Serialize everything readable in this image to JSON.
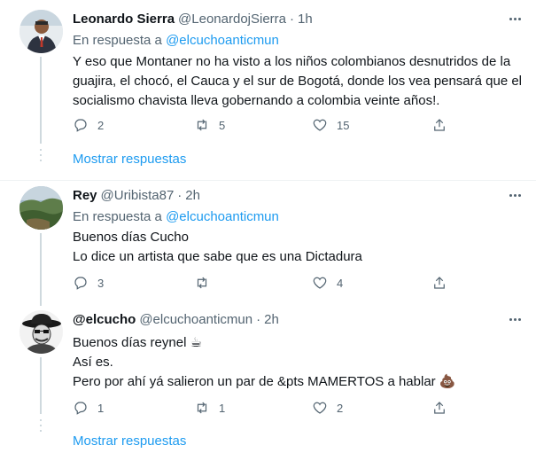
{
  "tweets": [
    {
      "name": "Leonardo Sierra",
      "handle": "@LeonardojSierra",
      "separator": "·",
      "time": "1h",
      "reply_prefix": "En respuesta a",
      "reply_mention": "@elcuchoanticmun",
      "lines": [
        "Y eso que Montaner no ha visto a los niños colombianos desnutridos de la",
        "guajira, el chocó, el Cauca y el sur de Bogotá, donde los vea pensará que el",
        "socialismo chavista lleva gobernando a colombia veinte años!."
      ],
      "replies": "2",
      "retweets": "5",
      "likes": "15",
      "avatar_icon": "profile-photo"
    },
    {
      "name": "Rey",
      "handle": "@Uribista87",
      "separator": "·",
      "time": "2h",
      "reply_prefix": "En respuesta a",
      "reply_mention": "@elcuchoanticmun",
      "lines": [
        "Buenos días Cucho",
        "Lo dice un artista que sabe que es una Dictadura"
      ],
      "replies": "3",
      "retweets": "",
      "likes": "4",
      "avatar_icon": "landscape-photo"
    },
    {
      "name": "@elcucho",
      "handle": "@elcuchoanticmun",
      "separator": "·",
      "time": "2h",
      "lines": [
        "Buenos días reynel",
        "Así es.",
        "Pero por ahí yá salieron un par de &pts MAMERTOS a hablar"
      ],
      "emoji_coffee": "☕",
      "emoji_poop": "💩",
      "replies": "1",
      "retweets": "1",
      "likes": "2",
      "avatar_icon": "hat-man-drawing"
    }
  ],
  "show_replies_label": "Mostrar respuestas",
  "colors": {
    "accent": "#1d9bf0",
    "text": "#0f1419",
    "muted": "#536471",
    "border": "#eff3f4"
  }
}
